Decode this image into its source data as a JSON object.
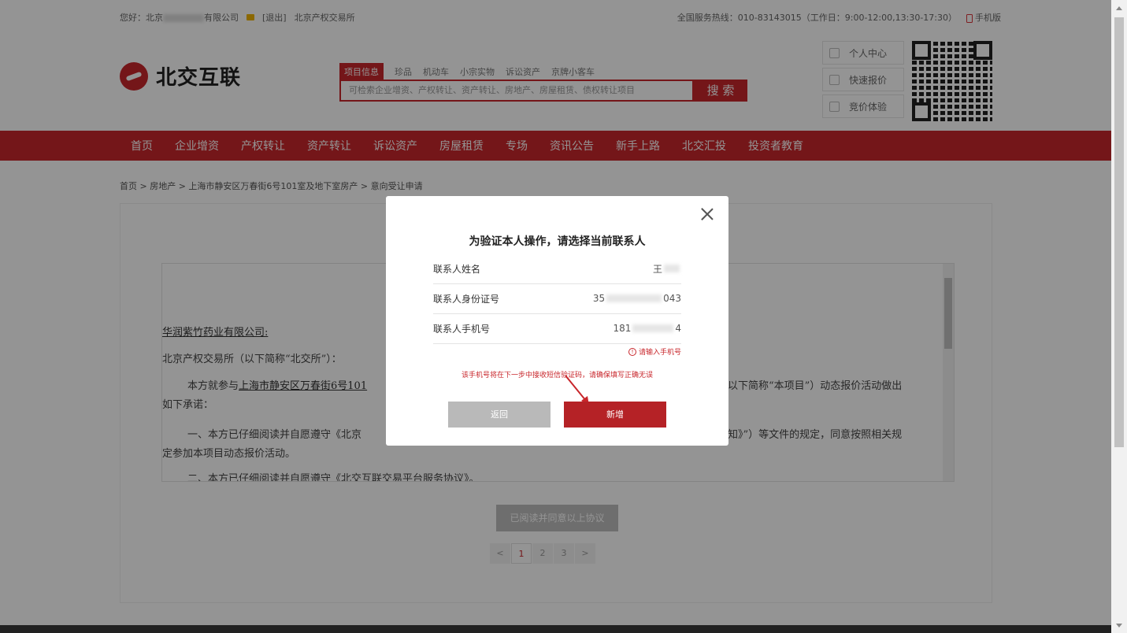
{
  "topbar": {
    "greeting": "您好：北京",
    "company_suffix": "有限公司",
    "logout": "[退出]",
    "exchange": "北京产权交易所",
    "hotline": "全国服务热线：010-83143015（工作日：9:00-12:00,13:30-17:30）",
    "mobile": "手机版"
  },
  "header": {
    "logo_text": "北交互联",
    "search_tabs": [
      "项目信息",
      "珍品",
      "机动车",
      "小宗实物",
      "诉讼资产",
      "京牌小客车"
    ],
    "search_placeholder": "可检索企业增资、产权转让、资产转让、房地产、房屋租赁、债权转让项目",
    "search_button": "搜 索",
    "quick_links": [
      "个人中心",
      "快速报价",
      "竞价体验"
    ]
  },
  "nav": [
    "首页",
    "企业增资",
    "产权转让",
    "资产转让",
    "诉讼资产",
    "房屋租赁",
    "专场",
    "资讯公告",
    "新手上路",
    "北交汇投",
    "投资者教育"
  ],
  "breadcrumb": "首页 > 房地产 > 上海市静安区万春街6号101室及地下室房产 > 意向受让申请",
  "agreement": {
    "addressee": "华润紫竹药业有限公司:",
    "line1": "北京产权交易所（以下简称“北交所”）：",
    "line2_a": "本方就参与",
    "line2_link": "上海市静安区万春街6号101",
    "line2_b": "以下简称“本项目”）动态报价活动做出",
    "line3": "如下承诺：",
    "line4_a": "一、本方已仔细阅读并自愿遵守《北京",
    "line4_b": "知》”）等文件的规定，同意按照相关规",
    "line5": "定参加本项目动态报价活动。",
    "line6": "二、本方已仔细阅读并自愿遵守《北交互联交易平台服务协议》。"
  },
  "agree_button": "已阅读并同意以上协议",
  "pager": [
    "<",
    "1",
    "2",
    "3",
    ">"
  ],
  "modal": {
    "title": "为验证本人操作，请选择当前联系人",
    "rows": [
      {
        "label": "联系人姓名",
        "prefix": "王",
        "suffix": ""
      },
      {
        "label": "联系人身份证号",
        "prefix": "35",
        "suffix": "043"
      },
      {
        "label": "联系人手机号",
        "prefix": "181",
        "suffix": "4"
      }
    ],
    "error": "请输入手机号",
    "notice": "该手机号将在下一步中接收短信验证码，请确保填写正确无误",
    "back_button": "返回",
    "add_button": "新增"
  },
  "colors": {
    "brand_red": "#c8262b",
    "button_red": "#b52226",
    "button_gray": "#b9b9b9"
  }
}
